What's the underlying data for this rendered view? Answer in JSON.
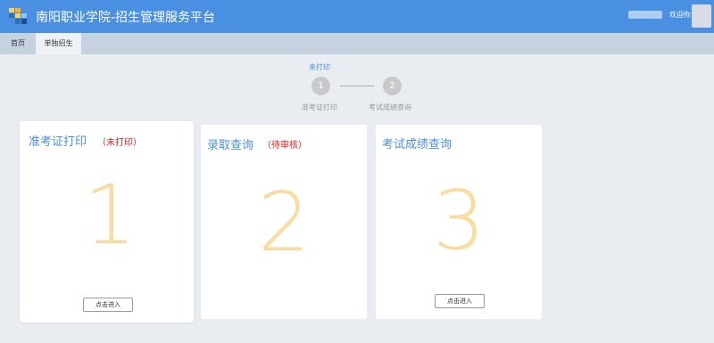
{
  "header": {
    "title": "南阳职业学院-招生管理服务平台",
    "welcome": "欢迎你",
    "bg_color": "#4a90e2"
  },
  "tabs": [
    {
      "label": "首页"
    },
    {
      "label": "单独招生"
    }
  ],
  "stepper": {
    "status": "未打印",
    "steps": [
      {
        "number": "1",
        "label": "准考证打印"
      },
      {
        "number": "2",
        "label": "考试成绩查询"
      }
    ]
  },
  "cards": [
    {
      "title": "准考证打印",
      "status": "（未打印）",
      "number": "1",
      "button": "点击进入"
    },
    {
      "title": "录取查询",
      "status": "（待审核）",
      "number": "2"
    },
    {
      "title": "考试成绩查询",
      "number": "3",
      "button": "点击进入"
    }
  ],
  "colors": {
    "accent": "#4a90e2",
    "status_red": "#e02020",
    "big_number": "#f8dca0"
  }
}
